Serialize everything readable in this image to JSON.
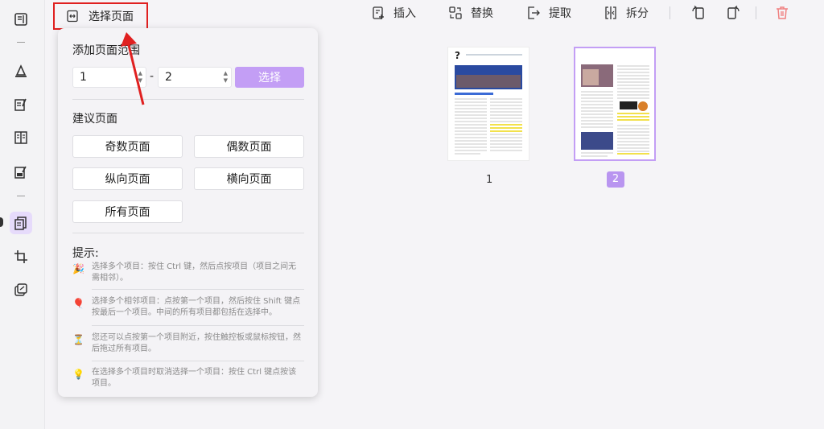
{
  "toolbar": {
    "select_pages": "选择页面",
    "insert": "插入",
    "replace": "替换",
    "extract": "提取",
    "split": "拆分"
  },
  "sidebar": {
    "items": [
      "reader-icon",
      "highlight-icon",
      "edit-icon",
      "compare-icon",
      "form-icon",
      "organize-pages-icon",
      "crop-icon",
      "batch-icon"
    ]
  },
  "panel": {
    "range_title": "添加页面范围",
    "range_from": "1",
    "range_to": "2",
    "range_dash": "-",
    "select_button": "选择",
    "suggest_title": "建议页面",
    "options": [
      "奇数页面",
      "偶数页面",
      "纵向页面",
      "横向页面",
      "所有页面"
    ],
    "tips_title": "提示:",
    "tips": [
      {
        "icon": "🎉",
        "text": "选择多个项目：按住 Ctrl 键，然后点按项目（项目之间无需相邻）。"
      },
      {
        "icon": "🎈",
        "text": "选择多个相邻项目：点按第一个项目，然后按住 Shift 键点按最后一个项目。中间的所有项目都包括在选择中。"
      },
      {
        "icon": "⏳",
        "text": "您还可以点按第一个项目附近，按住触控板或鼠标按钮，然后拖过所有项目。"
      },
      {
        "icon": "💡",
        "text": "在选择多个项目时取消选择一个项目：按住 Ctrl 键点按该项目。"
      }
    ]
  },
  "pages": [
    {
      "number": "1",
      "selected": false
    },
    {
      "number": "2",
      "selected": true
    }
  ],
  "colors": {
    "accent": "#c39ef5",
    "annotation": "#e02020",
    "delete": "#f08080"
  }
}
